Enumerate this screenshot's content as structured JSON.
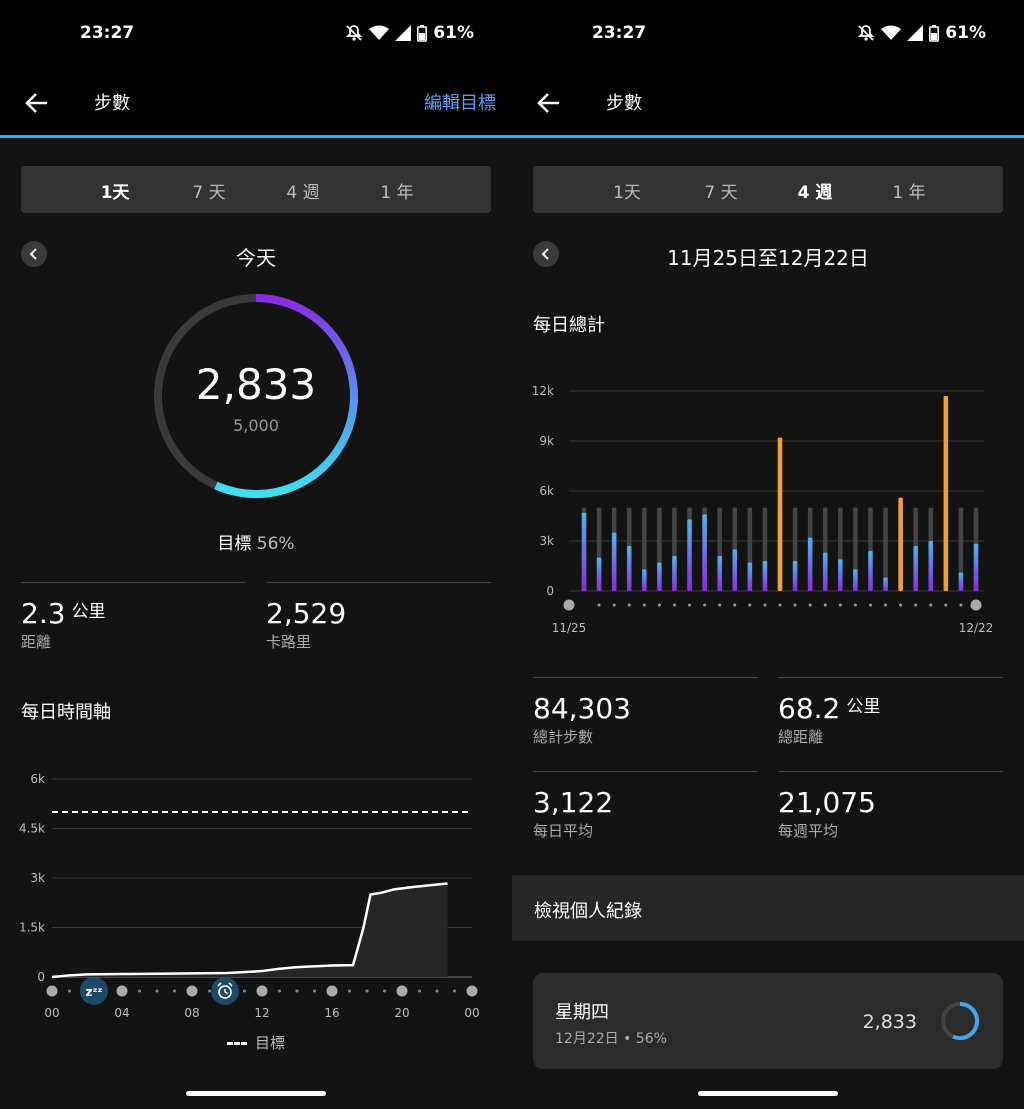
{
  "status": {
    "time": "23:27",
    "battery": "61%"
  },
  "left": {
    "app_title": "步數",
    "edit_goal": "編輯目標",
    "tabs": [
      "1天",
      "7 天",
      "4 週",
      "1 年"
    ],
    "active_tab": 0,
    "range_title": "今天",
    "steps": "2,833",
    "goal": "5,000",
    "goal_fraction": 0.567,
    "goal_label": "目標",
    "goal_percent": "56%",
    "distance_value": "2.3",
    "distance_unit": "公里",
    "distance_label": "距離",
    "calories_value": "2,529",
    "calories_label": "卡路里",
    "timeline_title": "每日時間軸",
    "legend_label": "目標",
    "icons": [
      "bell-off-icon",
      "wifi-icon",
      "signal-icon",
      "battery-icon",
      "back-arrow-icon",
      "chevron-left-icon",
      "sleep-icon",
      "alarm-icon"
    ]
  },
  "right": {
    "app_title": "步數",
    "tabs": [
      "1天",
      "7 天",
      "4 週",
      "1 年"
    ],
    "active_tab": 2,
    "range_title": "11月25日至12月22日",
    "daily_total_title": "每日總計",
    "stats": [
      {
        "value": "84,303",
        "unit": "",
        "label": "總計步數"
      },
      {
        "value": "68.2",
        "unit": "公里",
        "label": "總距離"
      },
      {
        "value": "3,122",
        "unit": "",
        "label": "每日平均"
      },
      {
        "value": "21,075",
        "unit": "",
        "label": "每週平均"
      }
    ],
    "records_label": "檢視個人紀錄",
    "day_card": {
      "name": "星期四",
      "date": "12月22日 • 56%",
      "steps": "2,833",
      "progress": 0.567
    }
  },
  "chart_data": [
    {
      "type": "area",
      "x_ticks": [
        "00",
        "04",
        "08",
        "12",
        "16",
        "20",
        "00"
      ],
      "y_ticks": [
        "0",
        "1.5k",
        "3k",
        "4.5k",
        "6k"
      ],
      "ylim": [
        0,
        6000
      ],
      "goal": 5000,
      "cumulative_steps": [
        [
          0,
          0
        ],
        [
          1,
          50
        ],
        [
          2,
          80
        ],
        [
          4,
          90
        ],
        [
          6,
          100
        ],
        [
          8,
          110
        ],
        [
          10,
          120
        ],
        [
          12,
          180
        ],
        [
          13,
          250
        ],
        [
          14,
          300
        ],
        [
          16,
          350
        ],
        [
          17.2,
          360
        ],
        [
          17.8,
          1500
        ],
        [
          18.2,
          2500
        ],
        [
          18.8,
          2550
        ],
        [
          19.5,
          2650
        ],
        [
          20.5,
          2720
        ],
        [
          21.8,
          2790
        ],
        [
          22.6,
          2833
        ]
      ],
      "colors": {
        "line": "#ffffff",
        "goal": "#ffffff"
      }
    },
    {
      "type": "bar",
      "x_start_label": "11/25",
      "x_end_label": "12/22",
      "y_ticks": [
        "0",
        "3k",
        "6k",
        "9k",
        "12k"
      ],
      "ylim": [
        0,
        12000
      ],
      "goal": 5000,
      "values": [
        4700,
        2000,
        3500,
        2700,
        1300,
        1700,
        2100,
        4300,
        4600,
        2100,
        2500,
        1700,
        1800,
        9200,
        1800,
        3200,
        2300,
        1900,
        1300,
        2400,
        800,
        5600,
        2700,
        3000,
        11700,
        1100,
        2833
      ],
      "colors": {
        "below_goal_top": "#4fb4e8",
        "below_goal_bottom": "#8a2be2",
        "above_goal": "#f0a03a",
        "goal_bar": "#444444"
      }
    }
  ]
}
